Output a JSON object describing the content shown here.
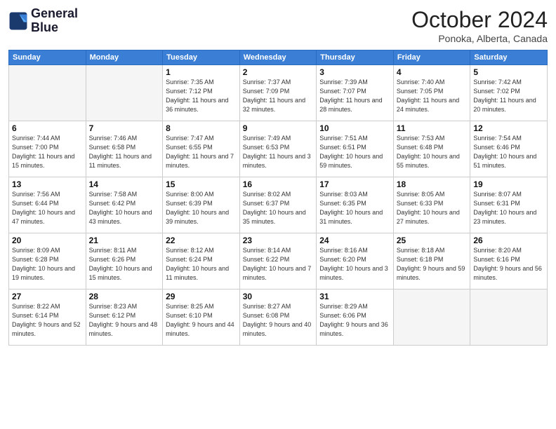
{
  "header": {
    "logo_line1": "General",
    "logo_line2": "Blue",
    "title": "October 2024",
    "location": "Ponoka, Alberta, Canada"
  },
  "days_of_week": [
    "Sunday",
    "Monday",
    "Tuesday",
    "Wednesday",
    "Thursday",
    "Friday",
    "Saturday"
  ],
  "weeks": [
    [
      {
        "day": "",
        "info": ""
      },
      {
        "day": "",
        "info": ""
      },
      {
        "day": "1",
        "info": "Sunrise: 7:35 AM\nSunset: 7:12 PM\nDaylight: 11 hours\nand 36 minutes."
      },
      {
        "day": "2",
        "info": "Sunrise: 7:37 AM\nSunset: 7:09 PM\nDaylight: 11 hours\nand 32 minutes."
      },
      {
        "day": "3",
        "info": "Sunrise: 7:39 AM\nSunset: 7:07 PM\nDaylight: 11 hours\nand 28 minutes."
      },
      {
        "day": "4",
        "info": "Sunrise: 7:40 AM\nSunset: 7:05 PM\nDaylight: 11 hours\nand 24 minutes."
      },
      {
        "day": "5",
        "info": "Sunrise: 7:42 AM\nSunset: 7:02 PM\nDaylight: 11 hours\nand 20 minutes."
      }
    ],
    [
      {
        "day": "6",
        "info": "Sunrise: 7:44 AM\nSunset: 7:00 PM\nDaylight: 11 hours\nand 15 minutes."
      },
      {
        "day": "7",
        "info": "Sunrise: 7:46 AM\nSunset: 6:58 PM\nDaylight: 11 hours\nand 11 minutes."
      },
      {
        "day": "8",
        "info": "Sunrise: 7:47 AM\nSunset: 6:55 PM\nDaylight: 11 hours\nand 7 minutes."
      },
      {
        "day": "9",
        "info": "Sunrise: 7:49 AM\nSunset: 6:53 PM\nDaylight: 11 hours\nand 3 minutes."
      },
      {
        "day": "10",
        "info": "Sunrise: 7:51 AM\nSunset: 6:51 PM\nDaylight: 10 hours\nand 59 minutes."
      },
      {
        "day": "11",
        "info": "Sunrise: 7:53 AM\nSunset: 6:48 PM\nDaylight: 10 hours\nand 55 minutes."
      },
      {
        "day": "12",
        "info": "Sunrise: 7:54 AM\nSunset: 6:46 PM\nDaylight: 10 hours\nand 51 minutes."
      }
    ],
    [
      {
        "day": "13",
        "info": "Sunrise: 7:56 AM\nSunset: 6:44 PM\nDaylight: 10 hours\nand 47 minutes."
      },
      {
        "day": "14",
        "info": "Sunrise: 7:58 AM\nSunset: 6:42 PM\nDaylight: 10 hours\nand 43 minutes."
      },
      {
        "day": "15",
        "info": "Sunrise: 8:00 AM\nSunset: 6:39 PM\nDaylight: 10 hours\nand 39 minutes."
      },
      {
        "day": "16",
        "info": "Sunrise: 8:02 AM\nSunset: 6:37 PM\nDaylight: 10 hours\nand 35 minutes."
      },
      {
        "day": "17",
        "info": "Sunrise: 8:03 AM\nSunset: 6:35 PM\nDaylight: 10 hours\nand 31 minutes."
      },
      {
        "day": "18",
        "info": "Sunrise: 8:05 AM\nSunset: 6:33 PM\nDaylight: 10 hours\nand 27 minutes."
      },
      {
        "day": "19",
        "info": "Sunrise: 8:07 AM\nSunset: 6:31 PM\nDaylight: 10 hours\nand 23 minutes."
      }
    ],
    [
      {
        "day": "20",
        "info": "Sunrise: 8:09 AM\nSunset: 6:28 PM\nDaylight: 10 hours\nand 19 minutes."
      },
      {
        "day": "21",
        "info": "Sunrise: 8:11 AM\nSunset: 6:26 PM\nDaylight: 10 hours\nand 15 minutes."
      },
      {
        "day": "22",
        "info": "Sunrise: 8:12 AM\nSunset: 6:24 PM\nDaylight: 10 hours\nand 11 minutes."
      },
      {
        "day": "23",
        "info": "Sunrise: 8:14 AM\nSunset: 6:22 PM\nDaylight: 10 hours\nand 7 minutes."
      },
      {
        "day": "24",
        "info": "Sunrise: 8:16 AM\nSunset: 6:20 PM\nDaylight: 10 hours\nand 3 minutes."
      },
      {
        "day": "25",
        "info": "Sunrise: 8:18 AM\nSunset: 6:18 PM\nDaylight: 9 hours\nand 59 minutes."
      },
      {
        "day": "26",
        "info": "Sunrise: 8:20 AM\nSunset: 6:16 PM\nDaylight: 9 hours\nand 56 minutes."
      }
    ],
    [
      {
        "day": "27",
        "info": "Sunrise: 8:22 AM\nSunset: 6:14 PM\nDaylight: 9 hours\nand 52 minutes."
      },
      {
        "day": "28",
        "info": "Sunrise: 8:23 AM\nSunset: 6:12 PM\nDaylight: 9 hours\nand 48 minutes."
      },
      {
        "day": "29",
        "info": "Sunrise: 8:25 AM\nSunset: 6:10 PM\nDaylight: 9 hours\nand 44 minutes."
      },
      {
        "day": "30",
        "info": "Sunrise: 8:27 AM\nSunset: 6:08 PM\nDaylight: 9 hours\nand 40 minutes."
      },
      {
        "day": "31",
        "info": "Sunrise: 8:29 AM\nSunset: 6:06 PM\nDaylight: 9 hours\nand 36 minutes."
      },
      {
        "day": "",
        "info": ""
      },
      {
        "day": "",
        "info": ""
      }
    ]
  ]
}
